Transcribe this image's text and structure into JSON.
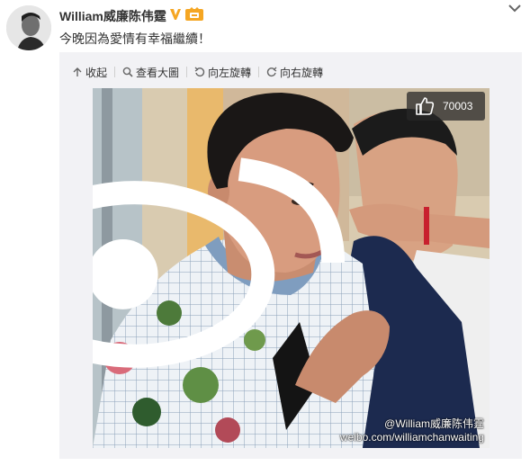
{
  "post": {
    "username": "William威廉陈伟霆",
    "text": "今晚因為愛情有幸福繼續！"
  },
  "toolbar": {
    "collapse_label": "收起",
    "view_large_label": "查看大圖",
    "rotate_left_label": "向左旋轉",
    "rotate_right_label": "向右旋轉"
  },
  "photo": {
    "like_count": "70003",
    "watermark_handle": "@William威廉陈伟霆",
    "watermark_url": "weibo.com/williamchanwaiting"
  },
  "colors": {
    "verified_badge": "#f5a623",
    "vip_badge": "#f5a623",
    "panel_bg": "#f2f2f5"
  },
  "icons": {
    "collapse": "collapse-arrow-icon",
    "view_large": "magnifier-icon",
    "rotate_left": "rotate-left-icon",
    "rotate_right": "rotate-right-icon",
    "like": "thumbs-up-icon",
    "more": "chevron-down-icon"
  }
}
